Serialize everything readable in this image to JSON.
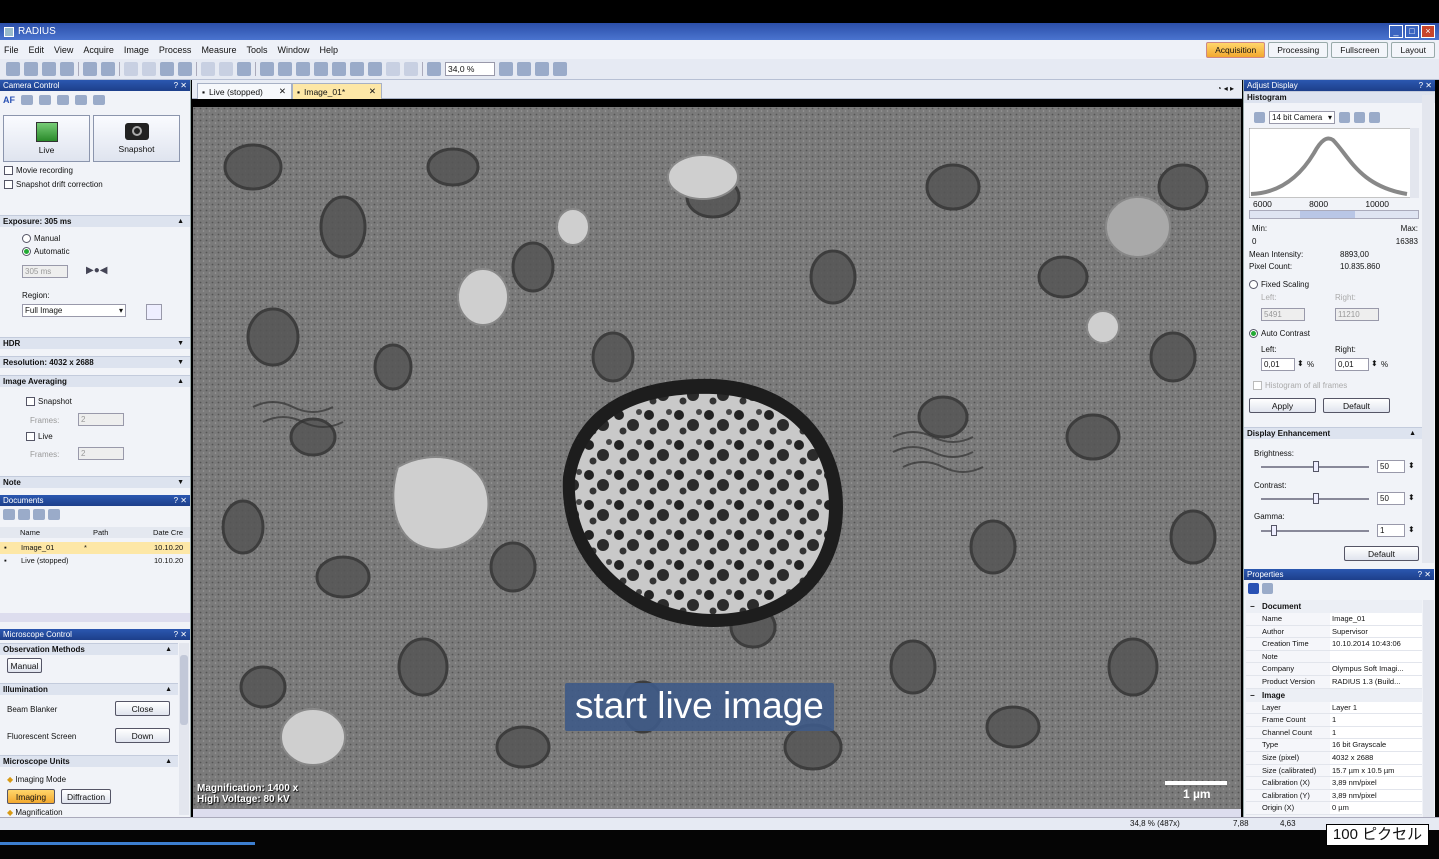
{
  "window": {
    "title": "RADIUS"
  },
  "menu": [
    "File",
    "Edit",
    "View",
    "Acquire",
    "Image",
    "Process",
    "Measure",
    "Tools",
    "Window",
    "Help"
  ],
  "mode_tabs": [
    "Acquisition",
    "Processing",
    "Fullscreen",
    "Layout"
  ],
  "toolbar": {
    "zoom": "34,0 %"
  },
  "camera_control": {
    "title": "Camera Control",
    "af": "AF",
    "live": "Live",
    "snapshot": "Snapshot",
    "movie_recording": "Movie recording",
    "snapshot_drift": "Snapshot drift correction",
    "exposure_header": "Exposure: 305 ms",
    "manual": "Manual",
    "automatic": "Automatic",
    "exposure_value": "305 ms",
    "region_label": "Region:",
    "region_value": "Full Image",
    "hdr": "HDR",
    "resolution": "Resolution: 4032 x 2688",
    "averaging": "Image Averaging",
    "avg_snapshot": "Snapshot",
    "avg_frames_label": "Frames:",
    "avg_frames": "2",
    "avg_live": "Live",
    "live_frames_label": "Frames:",
    "live_frames": "2",
    "note": "Note"
  },
  "documents": {
    "title": "Documents",
    "columns": [
      "Name",
      "Path",
      "Date Cre"
    ],
    "rows": [
      {
        "name": "Image_01",
        "path": "*",
        "date": "10.10.20"
      },
      {
        "name": "Live (stopped)",
        "path": "",
        "date": "10.10.20"
      }
    ]
  },
  "microscope": {
    "title": "Microscope Control",
    "obs_methods": "Observation Methods",
    "manual": "Manual",
    "illumination": "Illumination",
    "beam_blanker": "Beam Blanker",
    "close": "Close",
    "fluorescent_screen": "Fluorescent Screen",
    "down": "Down",
    "units": "Microscope Units",
    "imaging_mode": "Imaging Mode",
    "imaging": "Imaging",
    "diffraction": "Diffraction",
    "magnification": "Magnification"
  },
  "doc_tabs": [
    "Live (stopped)",
    "Image_01*"
  ],
  "image": {
    "magnification": "Magnification:  1400 x",
    "high_voltage": "High Voltage:    80 kV",
    "scale": "1 µm",
    "caption": "start live image"
  },
  "adjust_display": {
    "title": "Adjust Display",
    "histogram": "Histogram",
    "camera": "14 bit Camera",
    "ticks": [
      "6000",
      "8000",
      "10000"
    ],
    "min_label": "Min:",
    "max_label": "Max:",
    "min": "0",
    "max": "16383",
    "mean_label": "Mean Intensity:",
    "mean": "8893,00",
    "count_label": "Pixel Count:",
    "count": "10.835.860",
    "fixed_scaling": "Fixed Scaling",
    "left_label": "Left:",
    "right_label": "Right:",
    "fixed_left": "5491",
    "fixed_right": "11210",
    "auto_contrast": "Auto Contrast",
    "ac_left": "0,01",
    "ac_right": "0,01",
    "pct": "%",
    "hist_all": "Histogram of all frames",
    "apply": "Apply",
    "default": "Default"
  },
  "enhancement": {
    "title": "Display Enhancement",
    "brightness": "Brightness:",
    "brightness_val": "50",
    "contrast": "Contrast:",
    "contrast_val": "50",
    "gamma": "Gamma:",
    "gamma_val": "1",
    "default": "Default"
  },
  "properties": {
    "title": "Properties",
    "groups": [
      {
        "name": "Document",
        "rows": [
          [
            "Name",
            "Image_01"
          ],
          [
            "Author",
            "Supervisor"
          ],
          [
            "Creation Time",
            "10.10.2014 10:43:06"
          ],
          [
            "Note",
            ""
          ],
          [
            "Company",
            "Olympus Soft Imagi..."
          ],
          [
            "Product Version",
            "RADIUS 1.3 (Build..."
          ]
        ]
      },
      {
        "name": "Image",
        "rows": [
          [
            "Layer",
            "Layer 1"
          ],
          [
            "Frame Count",
            "1"
          ],
          [
            "Channel Count",
            "1"
          ],
          [
            "Type",
            "16 bit Grayscale"
          ],
          [
            "Size (pixel)",
            "4032 x 2688"
          ],
          [
            "Size (calibrated)",
            "15.7 µm x 10.5 µm"
          ],
          [
            "Calibration (X)",
            "3,89 nm/pixel"
          ],
          [
            "Calibration (Y)",
            "3,89 nm/pixel"
          ],
          [
            "Origin (X)",
            "0 µm"
          ]
        ]
      }
    ]
  },
  "status": {
    "zoom": "34,8 % (487x)",
    "x": "7,88",
    "y": "4,63"
  },
  "overlay": {
    "pixels": "100 ピクセル"
  }
}
